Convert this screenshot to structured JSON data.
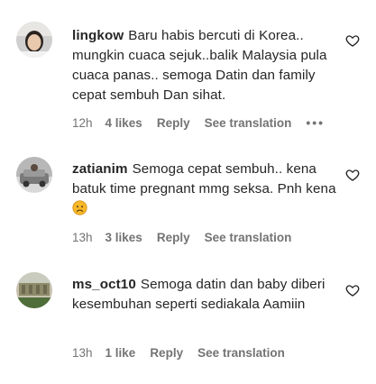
{
  "comments": [
    {
      "username": "lingkow",
      "text": "Baru habis bercuti di Korea.. mungkin cuaca sejuk..balik Malaysia pula cuaca panas.. semoga Datin dan family cepat sembuh Dan sihat.",
      "time": "12h",
      "likes": "4 likes",
      "reply": "Reply",
      "translation": "See translation",
      "more": "•••"
    },
    {
      "username": "zatianim",
      "text": "Semoga cepat sembuh.. kena batuk time pregnant mmg seksa. Pnh kena",
      "time": "13h",
      "likes": "3 likes",
      "reply": "Reply",
      "translation": "See translation"
    },
    {
      "username": "ms_oct10",
      "text": "Semoga datin dan baby diberi kesembuhan seperti sediakala Aamiin",
      "time": "13h",
      "likes": "1 like",
      "reply": "Reply",
      "translation": "See translation"
    }
  ],
  "icons": {
    "like": "heart-outline-icon",
    "emoji": "sad-face-emoji"
  },
  "colors": {
    "text": "#262626",
    "meta": "#737373",
    "background": "#ffffff"
  }
}
